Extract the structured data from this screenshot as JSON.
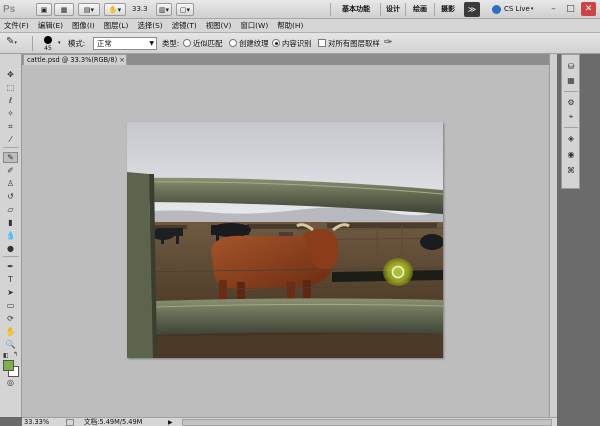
{
  "app": {
    "logo": "Ps",
    "zoom": "33.3",
    "workspaces": [
      "基本功能",
      "设计",
      "绘画",
      "摄影"
    ],
    "more": "≫",
    "cs_live": "CS Live",
    "window_controls": [
      "–",
      "□",
      "✕"
    ]
  },
  "menu": {
    "items": [
      "文件(F)",
      "编辑(E)",
      "图像(I)",
      "图层(L)",
      "选择(S)",
      "滤镜(T)",
      "视图(V)",
      "窗口(W)",
      "帮助(H)"
    ]
  },
  "options": {
    "brush_size": "45",
    "mode_label": "模式:",
    "mode_value": "正常",
    "type_label": "类型:",
    "type_options": [
      "近似匹配",
      "创建纹理",
      "内容识别"
    ],
    "type_selected": "内容识别",
    "sample_all_layers": "对所有图层取样"
  },
  "document": {
    "tab_title": "cattle.psd @ 33.3%(RGB/8)",
    "close": "×"
  },
  "status": {
    "zoom": "33.33%",
    "doc_info": "文档:5.49M/5.49M",
    "arrow": "▶"
  },
  "colors": {
    "foreground": "#7fb04b",
    "background": "#ffffff"
  }
}
